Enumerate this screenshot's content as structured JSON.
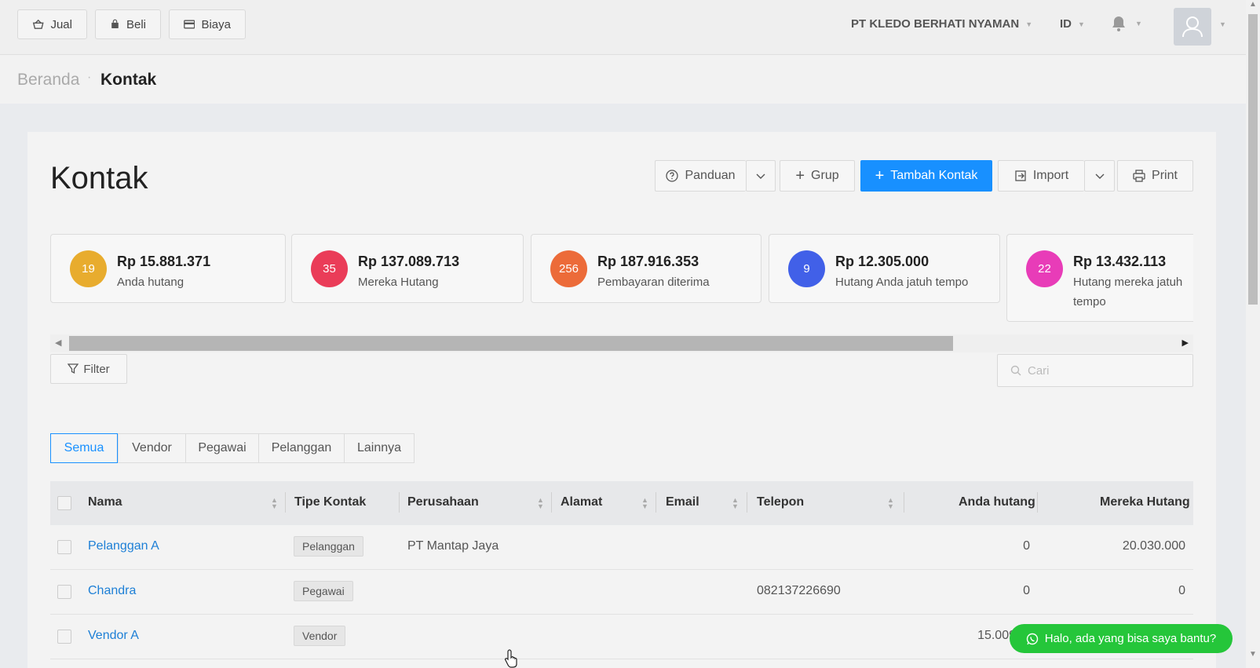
{
  "topbar": {
    "quick_buttons": [
      {
        "label": "Jual",
        "icon": "basket-icon"
      },
      {
        "label": "Beli",
        "icon": "bag-icon"
      },
      {
        "label": "Biaya",
        "icon": "credit-card-icon"
      }
    ],
    "company": "PT KLEDO BERHATI NYAMAN",
    "language": "ID"
  },
  "breadcrumb": {
    "home": "Beranda",
    "current": "Kontak"
  },
  "page": {
    "title": "Kontak",
    "buttons": {
      "guide": "Panduan",
      "group": "Grup",
      "add_contact": "Tambah Kontak",
      "import": "Import",
      "print": "Print"
    }
  },
  "stats": [
    {
      "count": "19",
      "amount": "Rp 15.881.371",
      "label": "Anda hutang",
      "color": "#e8ac2e"
    },
    {
      "count": "35",
      "amount": "Rp 137.089.713",
      "label": "Mereka Hutang",
      "color": "#ea3c58"
    },
    {
      "count": "256",
      "amount": "Rp 187.916.353",
      "label": "Pembayaran diterima",
      "color": "#ec6b39"
    },
    {
      "count": "9",
      "amount": "Rp 12.305.000",
      "label": "Hutang Anda jatuh tempo",
      "color": "#4160e8"
    },
    {
      "count": "22",
      "amount": "Rp 13.432.113",
      "label": "Hutang mereka jatuh tempo",
      "color": "#e83cb8"
    }
  ],
  "filter_label": "Filter",
  "search": {
    "placeholder": "Cari"
  },
  "tabs": [
    "Semua",
    "Vendor",
    "Pegawai",
    "Pelanggan",
    "Lainnya"
  ],
  "table": {
    "columns": [
      "Nama",
      "Tipe Kontak",
      "Perusahaan",
      "Alamat",
      "Email",
      "Telepon",
      "Anda hutang",
      "Mereka Hutang"
    ],
    "rows": [
      {
        "name": "Pelanggan A",
        "type": "Pelanggan",
        "company": "PT Mantap Jaya",
        "phone": "",
        "you_owe": "0",
        "they_owe": "20.030.000"
      },
      {
        "name": "Chandra",
        "type": "Pegawai",
        "company": "",
        "phone": "082137226690",
        "you_owe": "0",
        "they_owe": "0"
      },
      {
        "name": "Vendor A",
        "type": "Vendor",
        "company": "",
        "phone": "",
        "you_owe": "15.009",
        "they_owe": ""
      }
    ]
  },
  "chat": {
    "label": "Halo, ada yang bisa saya bantu?"
  }
}
